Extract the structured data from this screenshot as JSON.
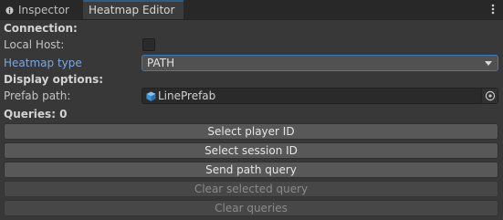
{
  "tabs": [
    {
      "label": "Inspector"
    },
    {
      "label": "Heatmap Editor"
    }
  ],
  "connection": {
    "heading": "Connection:",
    "local_host_label": "Local Host:",
    "local_host_checked": false,
    "heatmap_type_label": "Heatmap type",
    "heatmap_type_value": "PATH"
  },
  "display": {
    "heading": "Display options:",
    "prefab_path_label": "Prefab path:",
    "prefab_path_value": "LinePrefab"
  },
  "queries": {
    "heading": "Queries: 0"
  },
  "buttons": {
    "select_player": "Select player ID",
    "select_session": "Select session ID",
    "send_path_query": "Send path query",
    "clear_selected": "Clear selected query",
    "clear_queries": "Clear queries"
  },
  "colors": {
    "accent": "#3a79bb",
    "label_highlight": "#7ba7e2",
    "prefab_icon": "#4aa3e0"
  }
}
